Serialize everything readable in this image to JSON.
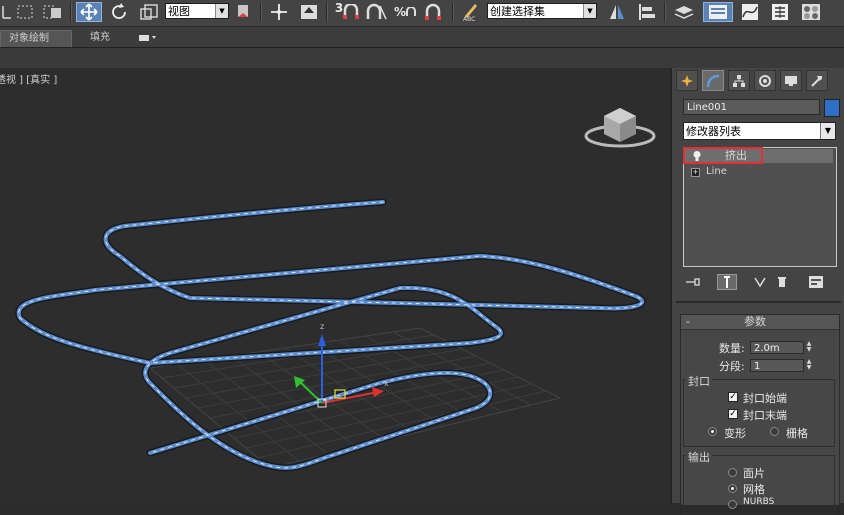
{
  "toolbar": {
    "view_dropdown": "视图",
    "selection_set_dropdown": "创建选择集",
    "snap_3": "3",
    "snap_percent": "%",
    "spinner_snap": "n"
  },
  "ribbon": {
    "tabs": [
      {
        "label": "对象绘制",
        "selected": true
      },
      {
        "label": "填充",
        "selected": false
      }
    ]
  },
  "viewport": {
    "label": "[透视 ] [真实 ]",
    "label_visible": "透视 ] [真实 ]",
    "axis_z": "z",
    "axis_x": "x",
    "object_color": "#5b8fd4"
  },
  "panel": {
    "object_name": "Line001",
    "object_color": "#2f6fc4",
    "modifier_list": "修改器列表",
    "stack": [
      {
        "label": "挤出",
        "selected": true
      },
      {
        "label": "Line",
        "selected": false
      }
    ],
    "parameters": {
      "title": "参数",
      "amount_label": "数量:",
      "amount_value": "2.0m",
      "segments_label": "分段:",
      "segments_value": "1",
      "capping_title": "封口",
      "cap_start": "封口始端",
      "cap_end": "封口末端",
      "morph": "变形",
      "grid": "栅格",
      "output_title": "输出",
      "patch": "面片",
      "mesh": "网格",
      "nurbs": "NURBS",
      "collapse_symbol": "-"
    }
  }
}
